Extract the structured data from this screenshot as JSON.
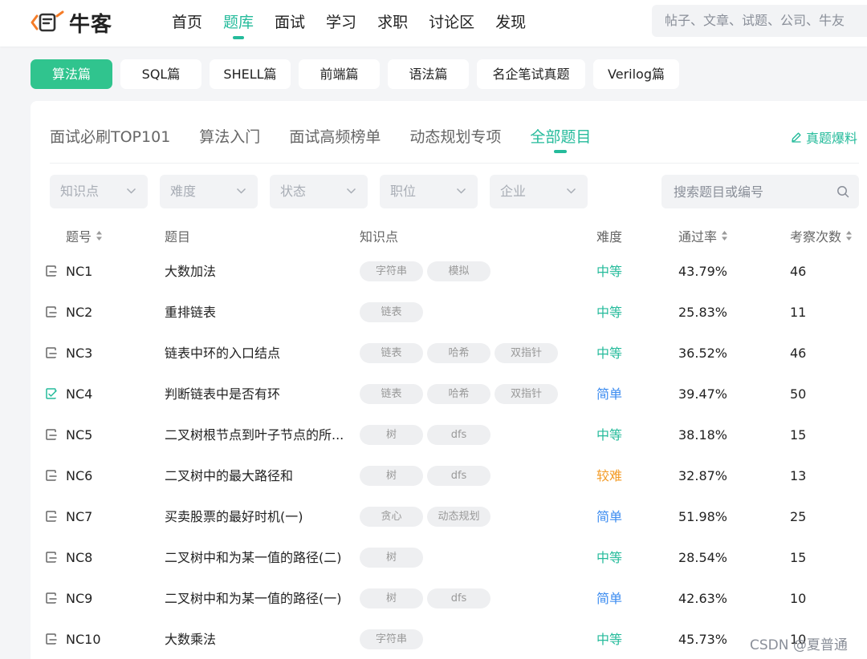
{
  "brand": {
    "name": "牛客",
    "accent": "#25bb9b",
    "logo_orange": "#f57c28"
  },
  "nav": {
    "items": [
      "首页",
      "题库",
      "面试",
      "学习",
      "求职",
      "讨论区",
      "发现"
    ],
    "active_index": 1
  },
  "global_search": {
    "placeholder": "帖子、文章、试题、公司、牛友"
  },
  "categories": {
    "items": [
      "算法篇",
      "SQL篇",
      "SHELL篇",
      "前端篇",
      "语法篇",
      "名企笔试真题",
      "Verilog篇"
    ],
    "active_index": 0
  },
  "subtabs": {
    "items": [
      "面试必刷TOP101",
      "算法入门",
      "面试高频榜单",
      "动态规划专项",
      "全部题目"
    ],
    "active_index": 4
  },
  "leak_link": {
    "label": "真题爆料",
    "icon": "pencil-icon"
  },
  "filters": [
    "知识点",
    "难度",
    "状态",
    "职位",
    "企业"
  ],
  "question_search": {
    "placeholder": "搜索题目或编号"
  },
  "table": {
    "headers": {
      "id": "题号",
      "title": "题目",
      "tags": "知识点",
      "difficulty": "难度",
      "pass_rate": "通过率",
      "count": "考察次数"
    },
    "difficulty_colors": {
      "中等": "#25bb9b",
      "简单": "#3c8cf0",
      "较难": "#f39c28"
    },
    "rows": [
      {
        "id": "NC1",
        "title": "大数加法",
        "tags": [
          "字符串",
          "模拟"
        ],
        "difficulty": "中等",
        "pass_rate": "43.79%",
        "count": "46",
        "solved": false
      },
      {
        "id": "NC2",
        "title": "重排链表",
        "tags": [
          "链表"
        ],
        "difficulty": "中等",
        "pass_rate": "25.83%",
        "count": "11",
        "solved": false
      },
      {
        "id": "NC3",
        "title": "链表中环的入口结点",
        "tags": [
          "链表",
          "哈希",
          "双指针"
        ],
        "difficulty": "中等",
        "pass_rate": "36.52%",
        "count": "46",
        "solved": false
      },
      {
        "id": "NC4",
        "title": "判断链表中是否有环",
        "tags": [
          "链表",
          "哈希",
          "双指针"
        ],
        "difficulty": "简单",
        "pass_rate": "39.47%",
        "count": "50",
        "solved": true
      },
      {
        "id": "NC5",
        "title": "二叉树根节点到叶子节点的所...",
        "tags": [
          "树",
          "dfs"
        ],
        "difficulty": "中等",
        "pass_rate": "38.18%",
        "count": "15",
        "solved": false
      },
      {
        "id": "NC6",
        "title": "二叉树中的最大路径和",
        "tags": [
          "树",
          "dfs"
        ],
        "difficulty": "较难",
        "pass_rate": "32.87%",
        "count": "13",
        "solved": false
      },
      {
        "id": "NC7",
        "title": "买卖股票的最好时机(一)",
        "tags": [
          "贪心",
          "动态规划"
        ],
        "difficulty": "简单",
        "pass_rate": "51.98%",
        "count": "25",
        "solved": false
      },
      {
        "id": "NC8",
        "title": "二叉树中和为某一值的路径(二)",
        "tags": [
          "树"
        ],
        "difficulty": "中等",
        "pass_rate": "28.54%",
        "count": "15",
        "solved": false
      },
      {
        "id": "NC9",
        "title": "二叉树中和为某一值的路径(一)",
        "tags": [
          "树",
          "dfs"
        ],
        "difficulty": "简单",
        "pass_rate": "42.63%",
        "count": "10",
        "solved": false
      },
      {
        "id": "NC10",
        "title": "大数乘法",
        "tags": [
          "字符串"
        ],
        "difficulty": "中等",
        "pass_rate": "45.73%",
        "count": "10",
        "solved": false
      }
    ]
  },
  "watermark": "CSDN @夏普通"
}
